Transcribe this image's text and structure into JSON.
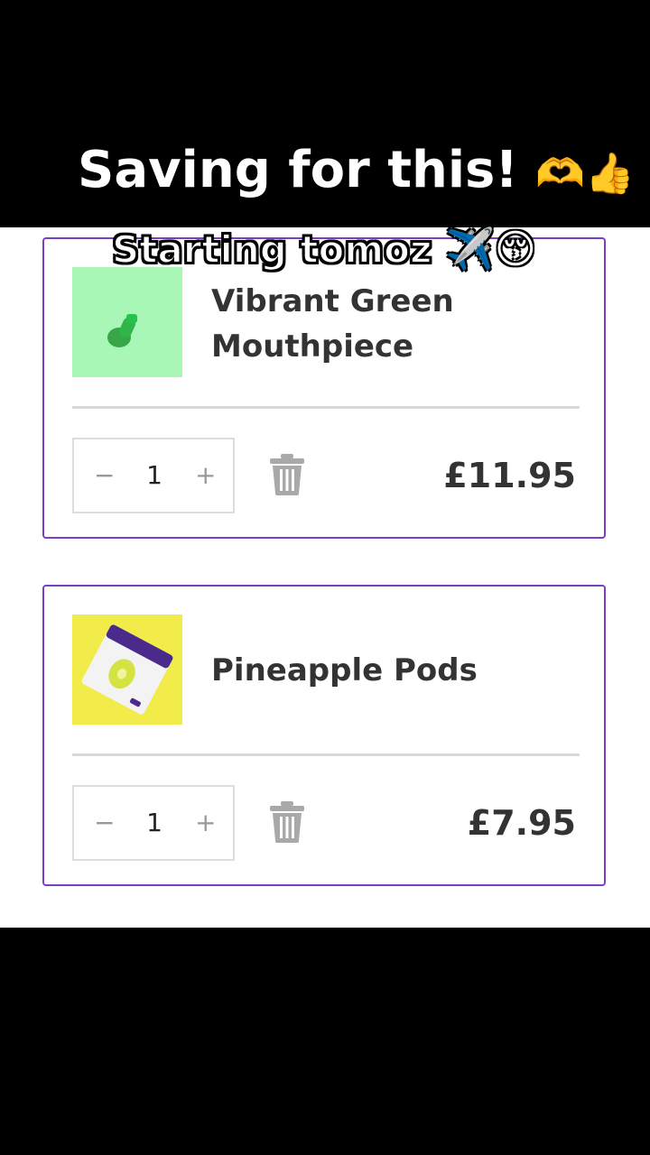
{
  "captions": {
    "main": "Saving for this!",
    "main_emoji": "🫶👍",
    "sub": "Starting tomoz",
    "sub_emoji": "✈️😚"
  },
  "cart": {
    "items": [
      {
        "title": "Vibrant Green Mouthpiece",
        "quantity": "1",
        "price": "£11.95",
        "minus_label": "−",
        "plus_label": "+",
        "thumb_color": "#a9f7b7"
      },
      {
        "title": "Pineapple Pods",
        "quantity": "1",
        "price": "£7.95",
        "minus_label": "−",
        "plus_label": "+",
        "thumb_color": "#f2ec4a"
      }
    ]
  },
  "colors": {
    "card_border": "#7b3fc6",
    "icon_gray": "#a9a9a9"
  }
}
